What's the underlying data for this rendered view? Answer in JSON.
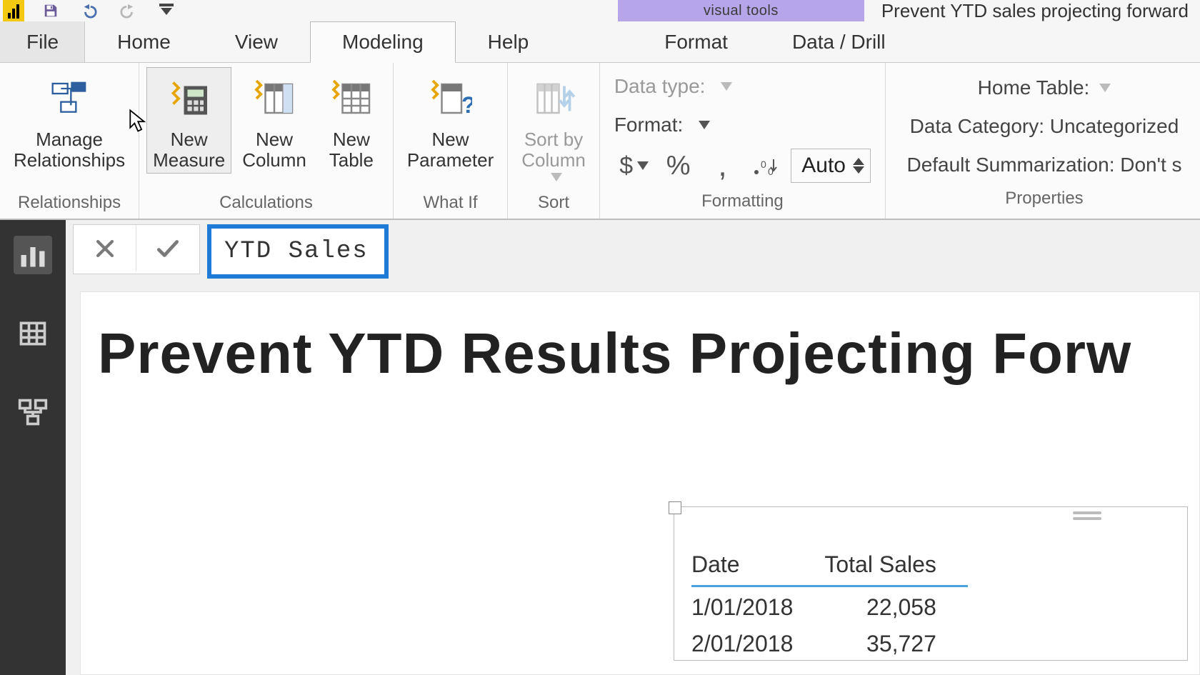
{
  "titlebar": {
    "context_label": "visual tools",
    "filename": "Prevent YTD sales projecting forward"
  },
  "tabs": {
    "file": "File",
    "home": "Home",
    "view": "View",
    "modeling": "Modeling",
    "help": "Help",
    "format": "Format",
    "data_drill": "Data / Drill"
  },
  "ribbon": {
    "relationships": {
      "manage": "Manage\nRelationships",
      "group_label": "Relationships"
    },
    "calculations": {
      "new_measure": "New\nMeasure",
      "new_column": "New\nColumn",
      "new_table": "New\nTable",
      "group_label": "Calculations"
    },
    "whatif": {
      "new_parameter": "New\nParameter",
      "group_label": "What If"
    },
    "sort": {
      "sort_by_column": "Sort by\nColumn",
      "group_label": "Sort"
    },
    "formatting": {
      "data_type_label": "Data type:",
      "format_label": "Format:",
      "auto": "Auto",
      "group_label": "Formatting"
    },
    "properties": {
      "home_table": "Home Table:",
      "data_category": "Data Category: Uncategorized",
      "default_summarization": "Default Summarization: Don't s",
      "group_label": "Properties"
    }
  },
  "formula": {
    "text": "YTD Sales = "
  },
  "report": {
    "title": "Prevent YTD Results Projecting Forw"
  },
  "table": {
    "headers": {
      "date": "Date",
      "total": "Total Sales"
    },
    "rows": [
      {
        "date": "1/01/2018",
        "total": "22,058"
      },
      {
        "date": "2/01/2018",
        "total": "35,727"
      }
    ]
  }
}
